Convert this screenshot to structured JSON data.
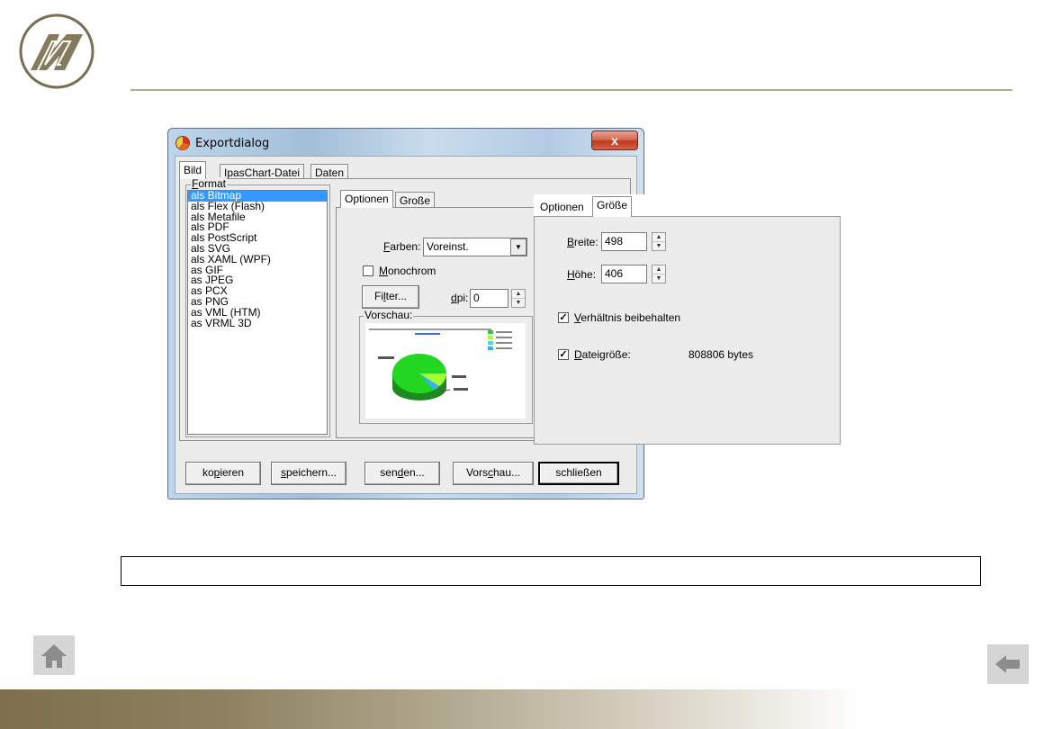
{
  "dialog": {
    "title": "Exportdialog",
    "close_label": "x",
    "tabs": [
      {
        "label": "Bild"
      },
      {
        "label": "IpasChart-Datei"
      },
      {
        "label": "Daten"
      }
    ],
    "format": {
      "label_mnemonic": "F",
      "label_rest": "ormat",
      "items": [
        {
          "label": "als Bitmap",
          "selected": true
        },
        {
          "label": "als Flex (Flash)"
        },
        {
          "label": "als Metafile"
        },
        {
          "label": "als PDF"
        },
        {
          "label": "als PostScript"
        },
        {
          "label": "als SVG"
        },
        {
          "label": "als XAML (WPF)"
        },
        {
          "label": "as GIF"
        },
        {
          "label": "as JPEG"
        },
        {
          "label": "as PCX"
        },
        {
          "label": "as PNG"
        },
        {
          "label": "as VML (HTM)"
        },
        {
          "label": "as VRML 3D"
        }
      ]
    },
    "inner_tabs": [
      {
        "label": "Optionen"
      },
      {
        "label": "Große"
      }
    ],
    "options": {
      "farben_mnemonic": "F",
      "farben_rest": "arben:",
      "farben_value": "Voreinst.",
      "monochrom_mnemonic": "M",
      "monochrom_rest": "onochrom",
      "monochrom_checked": false,
      "filter_pre": "Fi",
      "filter_mnemonic": "l",
      "filter_post": "ter...",
      "dpi_mnemonic": "d",
      "dpi_rest": "pi:",
      "dpi_value": "0",
      "vorschau_label": "Vorschau:"
    },
    "buttons": {
      "kopieren_pre": "ko",
      "kopieren_mn": "p",
      "kopieren_post": "ieren",
      "speichern_mn": "s",
      "speichern_post": "peichern...",
      "senden_pre": "sen",
      "senden_mn": "d",
      "senden_post": "en...",
      "vorschau_pre": "Vors",
      "vorschau_mn": "c",
      "vorschau_post": "hau...",
      "schliessen": "schließen"
    }
  },
  "size_panel": {
    "tabs": [
      {
        "label": "Optionen"
      },
      {
        "label": "Größe"
      }
    ],
    "breite_mnemonic": "B",
    "breite_rest": "reite:",
    "breite_value": "498",
    "hoehe_mnemonic": "H",
    "hoehe_rest": "öhe:",
    "hoehe_value": "406",
    "verhaeltnis_mnemonic": "V",
    "verhaeltnis_rest": "erhältnis beibehalten",
    "verhaeltnis_checked": true,
    "dateigroesse_mnemonic": "D",
    "dateigroesse_rest": "ateigröße:",
    "dateigroesse_checked": true,
    "dateigroesse_value": "808806 bytes"
  },
  "icons": {
    "logo": "company-logo-icon",
    "home": "home-icon",
    "back": "back-arrow-icon",
    "dialog": "chart-app-icon"
  },
  "colors": {
    "rule": "#b3ab8c",
    "footer_start": "#7d6f4c",
    "selection": "#3399ff"
  }
}
